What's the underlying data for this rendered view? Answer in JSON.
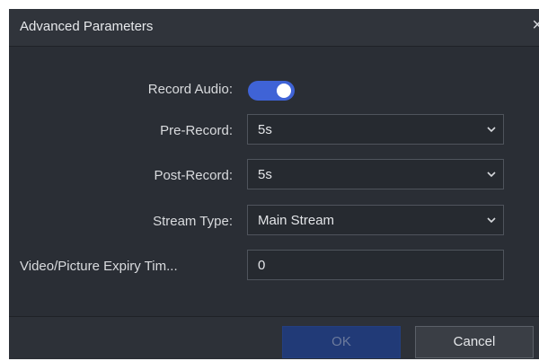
{
  "dialog": {
    "title": "Advanced Parameters",
    "close_glyph": "×"
  },
  "fields": {
    "record_audio": {
      "label": "Record Audio:",
      "enabled": true
    },
    "pre_record": {
      "label": "Pre-Record:",
      "value": "5s"
    },
    "post_record": {
      "label": "Post-Record:",
      "value": "5s"
    },
    "stream_type": {
      "label": "Stream Type:",
      "value": "Main Stream"
    },
    "expiry_time": {
      "label": "Video/Picture Expiry Tim...",
      "value": "0"
    }
  },
  "buttons": {
    "ok": "OK",
    "cancel": "Cancel"
  },
  "colors": {
    "dialog_bg": "#2a2e35",
    "accent": "#3f63d6",
    "ok_disabled": "#213a77"
  },
  "icons": {
    "close": "close-icon",
    "dropdown": "chevron-down-icon"
  }
}
